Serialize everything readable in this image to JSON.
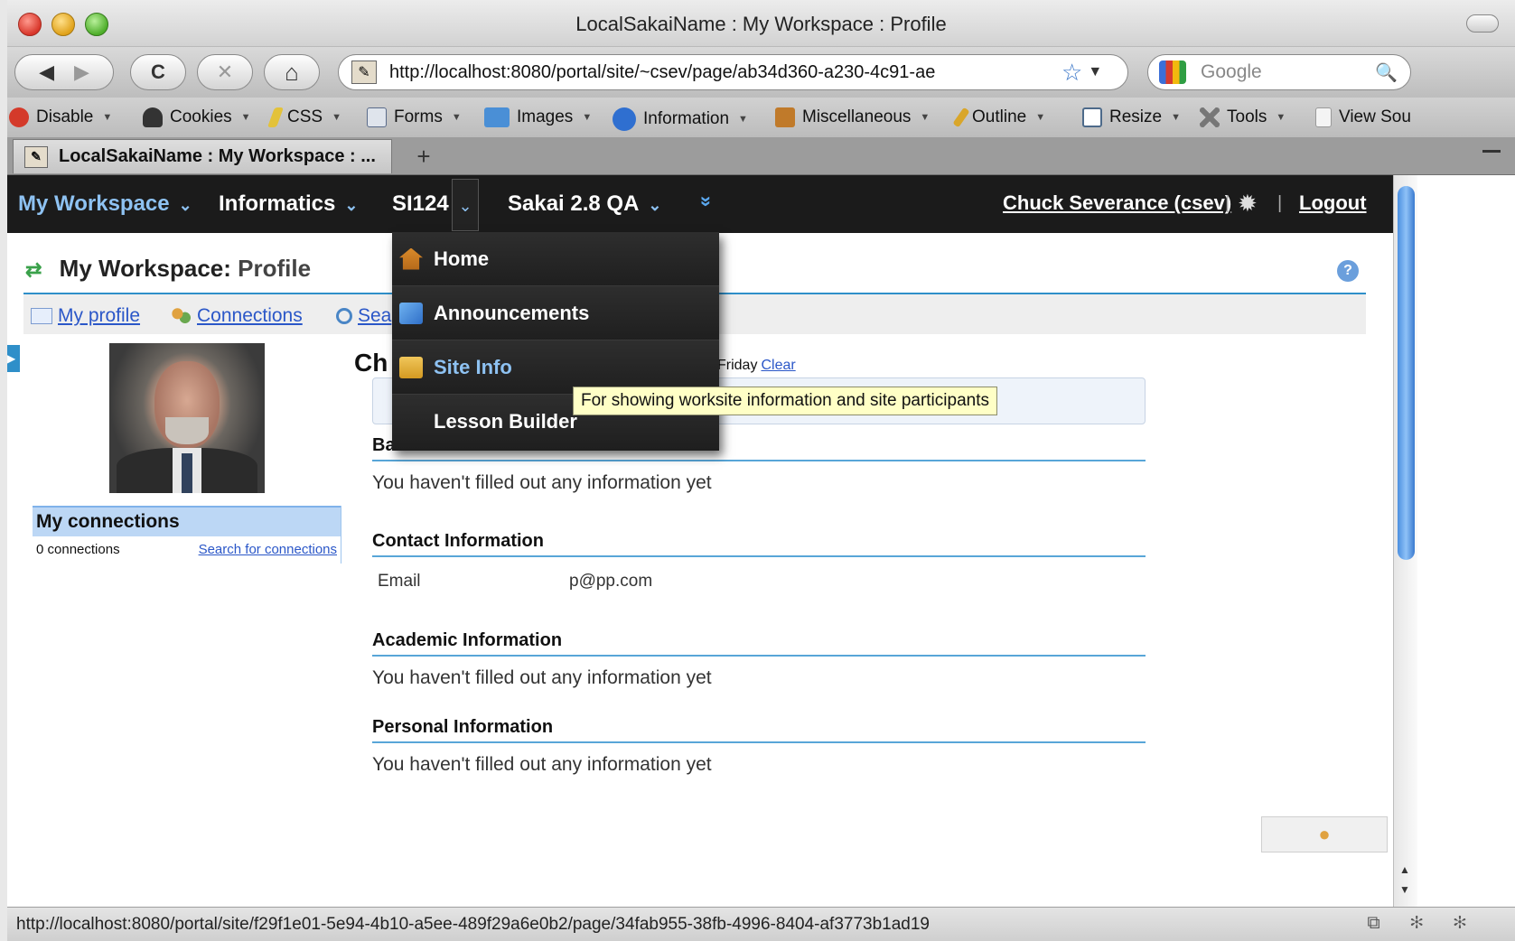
{
  "window": {
    "title": "LocalSakaiName : My Workspace : Profile"
  },
  "toolbar": {
    "back_icon": "◀",
    "forward_icon": "▶",
    "reload_icon": "C",
    "stop_icon": "✕",
    "home_icon": "⌂",
    "url": "http://localhost:8080/portal/site/~csev/page/ab34d360-a230-4c91-ae",
    "bookmark_icon": "☆",
    "url_dropdown_icon": "▼",
    "search_placeholder": "Google",
    "search_icon": "🔍"
  },
  "devbar": {
    "items": [
      {
        "label": "Disable",
        "icon": "disable-icon",
        "color": "#d43a2a"
      },
      {
        "label": "Cookies",
        "icon": "cookies-icon",
        "color": "#333333"
      },
      {
        "label": "CSS",
        "icon": "css-icon",
        "color": "#e3c23a"
      },
      {
        "label": "Forms",
        "icon": "forms-icon",
        "color": "#5a6b8a"
      },
      {
        "label": "Images",
        "icon": "images-icon",
        "color": "#4a8fd6"
      },
      {
        "label": "Information",
        "icon": "information-icon",
        "color": "#2f6fd0"
      },
      {
        "label": "Miscellaneous",
        "icon": "miscellaneous-icon",
        "color": "#c07a2a"
      },
      {
        "label": "Outline",
        "icon": "outline-icon",
        "color": "#d9a62a"
      },
      {
        "label": "Resize",
        "icon": "resize-icon",
        "color": "#4d6a8a"
      },
      {
        "label": "Tools",
        "icon": "tools-icon",
        "color": "#777777"
      },
      {
        "label": "View Sou",
        "icon": "view-source-icon",
        "color": "#9a9a9a"
      }
    ]
  },
  "tabs": {
    "active_label": "LocalSakaiName : My Workspace : ...",
    "new_tab_label": "+"
  },
  "sakai_nav": {
    "sites": [
      "My Workspace",
      "Informatics",
      "SI124",
      "Sakai 2.8 QA"
    ],
    "caret": "⌄",
    "more_icon": "»",
    "user": "Chuck Severance (csev)",
    "separator": "|",
    "gear_icon": "✹",
    "logout": "Logout"
  },
  "page": {
    "title_site": "My Workspace:",
    "title_tool": "Profile",
    "reset_icon": "⇄",
    "help_icon": "?",
    "subnav": [
      "My profile",
      "Connections",
      "Sea"
    ]
  },
  "sidebar": {
    "connections_title": "My connections",
    "connections_count": "0 connections",
    "search_link": "Search for connections"
  },
  "main": {
    "heading_partial": "Ch",
    "status_day": "Friday",
    "status_clear": "Clear",
    "basic_head": "Basic Information",
    "basic_body": "You haven't filled out any information yet",
    "contact_head": "Contact Information",
    "email_label": "Email",
    "email_value": "p@pp.com",
    "academic_head": "Academic Information",
    "academic_body": "You haven't filled out any information yet",
    "personal_head": "Personal Information",
    "personal_body": "You haven't filled out any information yet"
  },
  "dropdown": {
    "items": [
      {
        "label": "Home",
        "icon": "home-icon",
        "color": "#d98a2a"
      },
      {
        "label": "Announcements",
        "icon": "announcements-icon",
        "color": "#4a90d8"
      },
      {
        "label": "Site Info",
        "icon": "site-info-icon",
        "color": "#e3b23a"
      },
      {
        "label": "Lesson Builder",
        "icon": "lesson-builder-icon",
        "color": "#1e1e1e"
      }
    ],
    "tooltip": "For showing worksite information and site participants"
  },
  "statusbar": {
    "url": "http://localhost:8080/portal/site/f29f1e01-5e94-4b10-a5ee-489f29a6e0b2/page/34fab955-38fb-4996-8404-af3773b1ad19",
    "icons": "⧉ ✻ ✻"
  }
}
